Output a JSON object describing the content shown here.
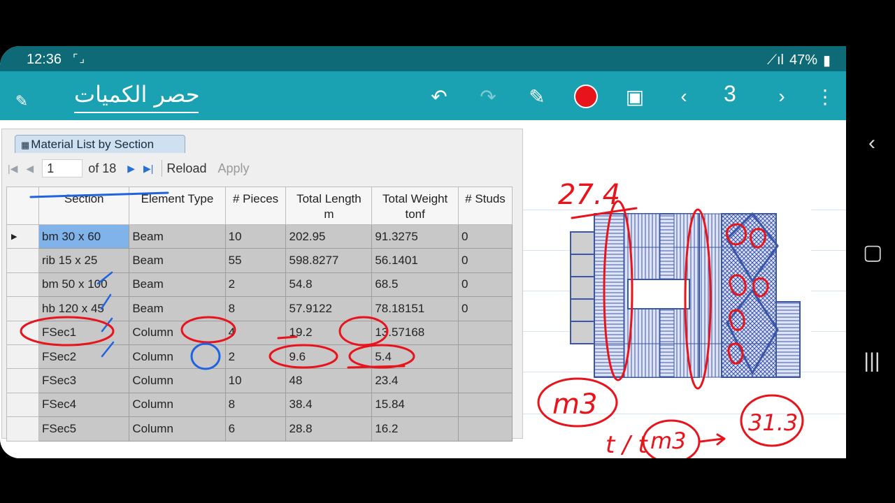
{
  "status": {
    "time": "12:36",
    "battery": "47%"
  },
  "app": {
    "title": "حصر الكميات",
    "page_number": "3"
  },
  "report": {
    "tab_label": "Material List by Section",
    "page_input": "1",
    "page_of": "of 18",
    "reload_label": "Reload",
    "apply_label": "Apply",
    "columns": [
      "Section",
      "Element Type",
      "# Pieces",
      "Total Length\nm",
      "Total Weight\ntonf",
      "# Studs"
    ],
    "rows": [
      [
        "bm 30 x 60",
        "Beam",
        "10",
        "202.95",
        "91.3275",
        "0"
      ],
      [
        "rib 15 x 25",
        "Beam",
        "55",
        "598.8277",
        "56.1401",
        "0"
      ],
      [
        "bm 50 x 100",
        "Beam",
        "2",
        "54.8",
        "68.5",
        "0"
      ],
      [
        "hb 120 x 45",
        "Beam",
        "8",
        "57.9122",
        "78.18151",
        "0"
      ],
      [
        "FSec1",
        "Column",
        "4",
        "19.2",
        "13.57168",
        ""
      ],
      [
        "FSec2",
        "Column",
        "2",
        "9.6",
        "5.4",
        ""
      ],
      [
        "FSec3",
        "Column",
        "10",
        "48",
        "23.4",
        ""
      ],
      [
        "FSec4",
        "Column",
        "8",
        "38.4",
        "15.84",
        ""
      ],
      [
        "FSec5",
        "Column",
        "6",
        "28.8",
        "16.2",
        ""
      ]
    ]
  },
  "handwriting": {
    "top_value": "27.4",
    "m3_left": "m3",
    "t_over_t": "t / t",
    "m3_right": "m3",
    "right_value": "31.3"
  },
  "colors": {
    "appbar": "#1aa2b2",
    "statusbar": "#0e6a77",
    "ink_red": "#e8141c",
    "ink_blue": "#1e63e0",
    "grid_blue": "#3b56a8"
  }
}
